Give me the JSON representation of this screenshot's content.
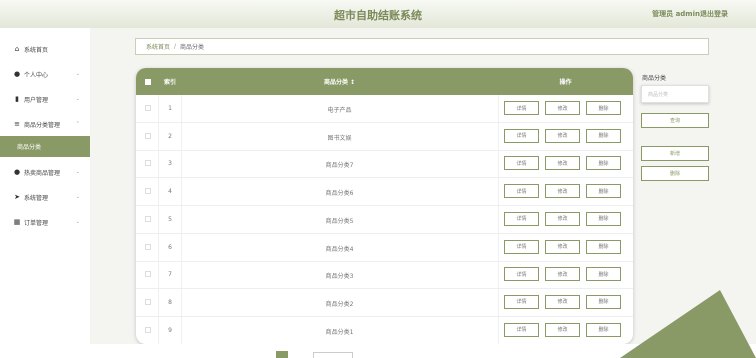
{
  "header": {
    "title": "超市自助结账系统",
    "user": "管理员 admin",
    "logout": "退出登录"
  },
  "sidebar": {
    "items": [
      {
        "icon": "home-icon",
        "glyph": "⌂",
        "label": "系统首页",
        "expandable": false
      },
      {
        "icon": "user-icon",
        "glyph": "●",
        "label": "个人中心",
        "expandable": true
      },
      {
        "icon": "users-icon",
        "glyph": "▮",
        "label": "用户管理",
        "expandable": true
      },
      {
        "icon": "list-icon",
        "glyph": "≡",
        "label": "商品分类管理",
        "expandable": true,
        "expanded": true
      },
      {
        "icon": "person-icon",
        "glyph": "●",
        "label": "热卖商品管理",
        "expandable": true
      },
      {
        "icon": "send-icon",
        "glyph": "➤",
        "label": "系统管理",
        "expandable": true
      },
      {
        "icon": "grid-icon",
        "glyph": "▦",
        "label": "订单管理",
        "expandable": true
      }
    ],
    "submenu": {
      "label": "商品分类"
    },
    "chevron_down": "⌄",
    "chevron_up": "⌃"
  },
  "breadcrumb": {
    "home": "系统首页",
    "separator": "/",
    "current": "商品分类"
  },
  "table": {
    "headers": {
      "index": "索引",
      "category": "商品分类 ↕",
      "actions": "操作"
    },
    "rows": [
      {
        "index": "1",
        "category": "电子产品"
      },
      {
        "index": "2",
        "category": "图书文娱"
      },
      {
        "index": "3",
        "category": "商品分类7"
      },
      {
        "index": "4",
        "category": "商品分类6"
      },
      {
        "index": "5",
        "category": "商品分类5"
      },
      {
        "index": "6",
        "category": "商品分类4"
      },
      {
        "index": "7",
        "category": "商品分类3"
      },
      {
        "index": "8",
        "category": "商品分类2"
      },
      {
        "index": "9",
        "category": "商品分类1"
      }
    ],
    "actions": {
      "detail": "详情",
      "edit": "修改",
      "delete": "删除"
    }
  },
  "search": {
    "label": "商品分类",
    "placeholder": "商品分类",
    "query_btn": "查询",
    "add_btn": "新增",
    "delete_btn": "删除"
  },
  "colors": {
    "accent": "#8a9a66",
    "header_text": "#7a8a5a"
  }
}
